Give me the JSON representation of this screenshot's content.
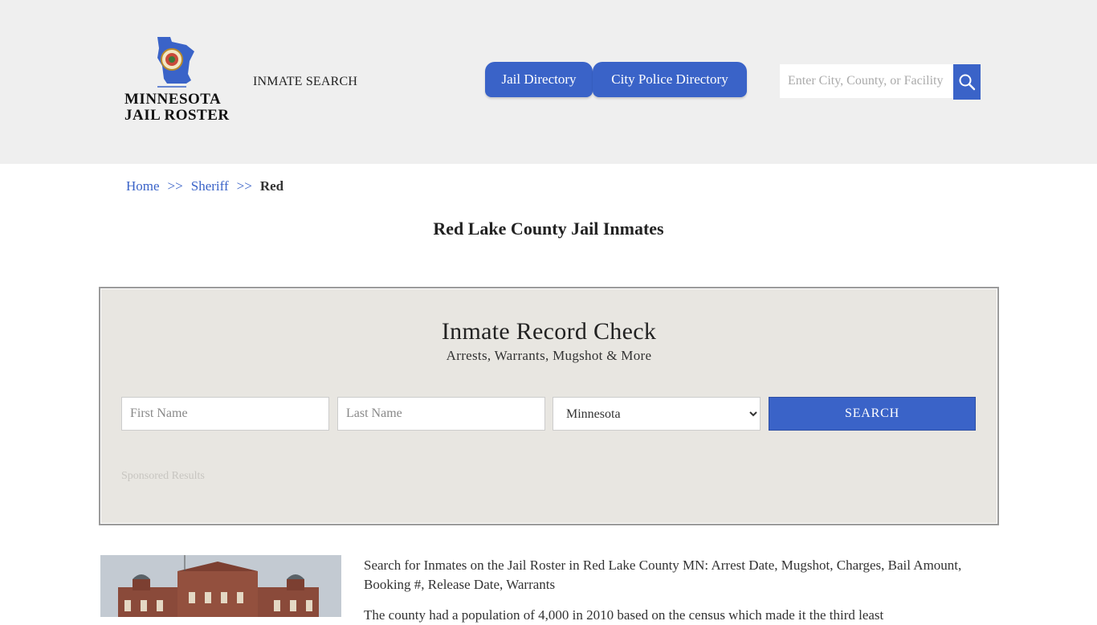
{
  "header": {
    "logo_line1": "MINNESOTA",
    "logo_line2": "JAIL ROSTER",
    "nav_inmate_search": "INMATE SEARCH",
    "tabs": [
      {
        "label": "Jail Directory"
      },
      {
        "label": "City Police Directory"
      }
    ],
    "search": {
      "placeholder": "Enter City, County, or Facility"
    }
  },
  "breadcrumb": {
    "home": "Home",
    "sep1": ">>",
    "sheriff": "Sheriff",
    "sep2": ">>",
    "current": "Red"
  },
  "page_title": "Red Lake County Jail Inmates",
  "record_check": {
    "title": "Inmate Record Check",
    "subtitle": "Arrests, Warrants, Mugshot & More",
    "first_name_placeholder": "First Name",
    "last_name_placeholder": "Last Name",
    "state_selected": "Minnesota",
    "search_label": "SEARCH",
    "sponsored": "Sponsored Results"
  },
  "content": {
    "description": "Search for Inmates on the Jail Roster in Red Lake County MN: Arrest Date, Mugshot, Charges, Bail Amount, Booking #, Release Date, Warrants",
    "description2": "The county had a population of 4,000 in 2010 based on the census which made it the third least"
  },
  "colors": {
    "accent": "#3a63c8",
    "header_bg": "#efefef",
    "panel_bg": "#e8e6e1"
  }
}
